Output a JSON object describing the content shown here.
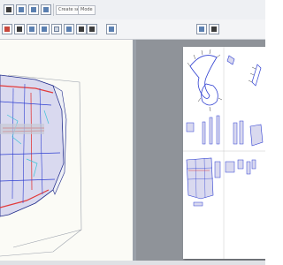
{
  "toolbar": {
    "text_buttons": [
      "Create settings",
      "Mode"
    ]
  },
  "icons": {
    "row1": [
      "select-icon",
      "rotate-icon",
      "pan-icon",
      "zoom-icon",
      "link-icon",
      "save-icon",
      "print-icon",
      "unfold-icon"
    ],
    "row2": [
      "fold-icon",
      "flip-icon",
      "face-select-icon",
      "edge-select-icon",
      "page-icon",
      "join-icon",
      "text-icon",
      "print-icon",
      "settings-icon",
      "grid-icon",
      "pattern-icon"
    ]
  },
  "colors": {
    "model_fill": "#d9d9ef",
    "cut_line": "#e23a3a",
    "fold_line": "#2f3fd1",
    "accent_cyan": "#3ec3d9",
    "paper": "#ffffff",
    "workspace": "#8f9399"
  }
}
